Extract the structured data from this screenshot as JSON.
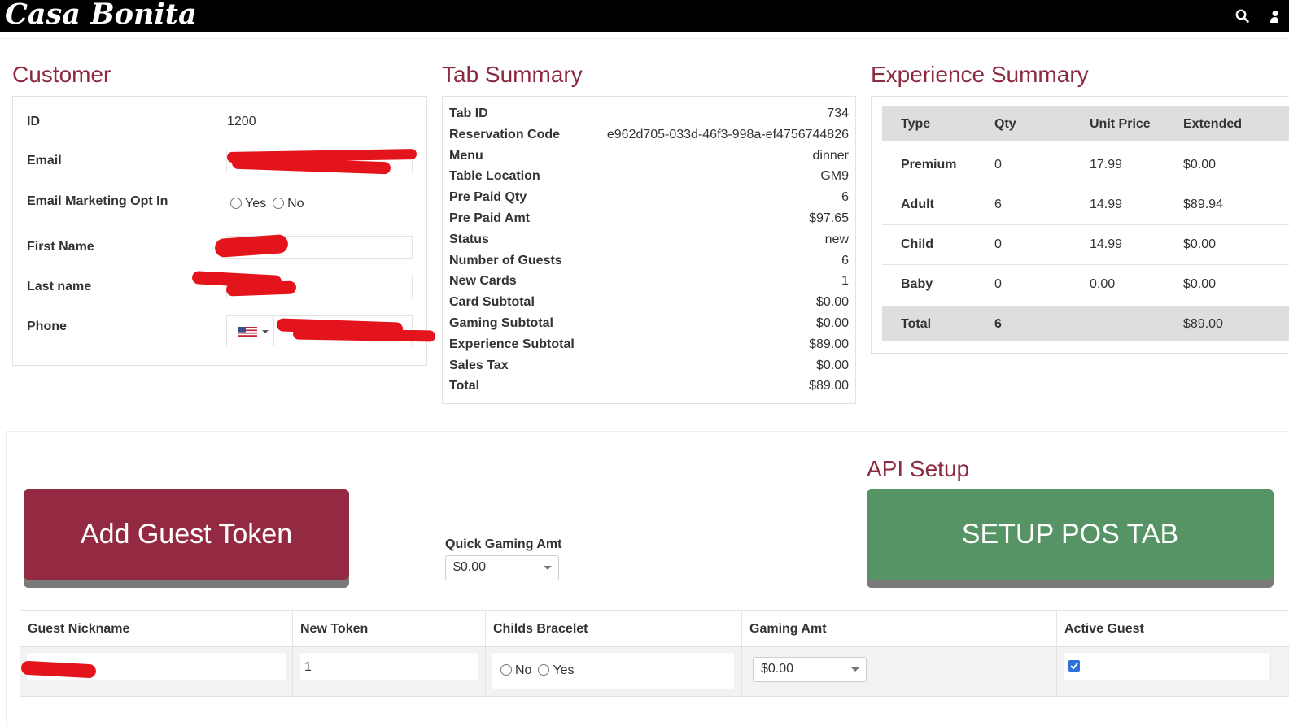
{
  "header": {
    "logo": "Casa Bonita"
  },
  "customer": {
    "title": "Customer",
    "id_label": "ID",
    "id_value": "1200",
    "email_label": "Email",
    "opt_in_label": "Email Marketing Opt In",
    "opt_yes": "Yes",
    "opt_no": "No",
    "first_name_label": "First Name",
    "last_name_label": "Last name",
    "phone_label": "Phone"
  },
  "tab_summary": {
    "title": "Tab Summary",
    "rows": [
      {
        "k": "Tab ID",
        "v": "734"
      },
      {
        "k": "Reservation Code",
        "v": "e962d705-033d-46f3-998a-ef4756744826"
      },
      {
        "k": "Menu",
        "v": "dinner"
      },
      {
        "k": "Table Location",
        "v": "GM9"
      },
      {
        "k": "Pre Paid Qty",
        "v": "6"
      },
      {
        "k": "Pre Paid Amt",
        "v": "$97.65"
      },
      {
        "k": "Status",
        "v": "new"
      },
      {
        "k": "Number of Guests",
        "v": "6"
      },
      {
        "k": "New Cards",
        "v": "1"
      },
      {
        "k": "Card Subtotal",
        "v": "$0.00"
      },
      {
        "k": "Gaming Subtotal",
        "v": "$0.00"
      },
      {
        "k": "Experience Subtotal",
        "v": "$89.00"
      },
      {
        "k": "Sales Tax",
        "v": "$0.00"
      },
      {
        "k": "Total",
        "v": "$89.00"
      }
    ]
  },
  "experience": {
    "title": "Experience Summary",
    "headers": {
      "type": "Type",
      "qty": "Qty",
      "unit": "Unit Price",
      "ext": "Extended"
    },
    "rows": [
      {
        "type": "Premium",
        "qty": "0",
        "unit": "17.99",
        "ext": "$0.00"
      },
      {
        "type": "Adult",
        "qty": "6",
        "unit": "14.99",
        "ext": "$89.94"
      },
      {
        "type": "Child",
        "qty": "0",
        "unit": "14.99",
        "ext": "$0.00"
      },
      {
        "type": "Baby",
        "qty": "0",
        "unit": "0.00",
        "ext": "$0.00"
      }
    ],
    "total": {
      "type": "Total",
      "qty": "6",
      "unit": "",
      "ext": "$89.00"
    }
  },
  "actions": {
    "add_guest_label": "Add Guest Token",
    "quick_gaming_label": "Quick Gaming Amt",
    "quick_gaming_value": "$0.00",
    "api_title": "API Setup",
    "setup_pos_label": "SETUP POS TAB"
  },
  "guest_table": {
    "headers": {
      "nickname": "Guest Nickname",
      "token": "New Token",
      "bracelet": "Childs Bracelet",
      "gaming": "Gaming Amt",
      "active": "Active Guest"
    },
    "row": {
      "token": "1",
      "bracelet_no": "No",
      "bracelet_yes": "Yes",
      "gaming": "$0.00",
      "active": true
    }
  },
  "colors": {
    "accent": "#8c2a3f",
    "add_button": "#942a41",
    "setup_button": "#579465"
  }
}
